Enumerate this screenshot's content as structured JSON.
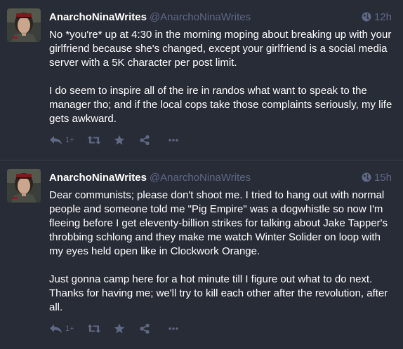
{
  "statuses": [
    {
      "display_name": "AnarchoNinaWrites",
      "handle": "@AnarchoNinaWrites",
      "time": "12h",
      "paragraphs": [
        "No *you're* up at 4:30 in the morning moping about breaking up with your girlfriend because she's changed, except your girlfriend is a social media server with a 5K character per post limit.",
        "I do seem to inspire all of the ire in randos what want to speak to the manager tho; and if the local cops take those complaints seriously, my life gets awkward."
      ],
      "reply_count": "1+"
    },
    {
      "display_name": "AnarchoNinaWrites",
      "handle": "@AnarchoNinaWrites",
      "time": "15h",
      "paragraphs": [
        "Dear communists; please don't shoot me. I tried to hang out with normal people and someone told me \"Pig Empire\" was a dogwhistle so now I'm fleeing before I get eleventy-billion strikes for talking about Jake Tapper's throbbing schlong and they make me watch Winter Solider on loop with my eyes held open like in Clockwork Orange.",
        "Just gonna camp here for a hot minute till I figure out what to do next. Thanks for having me; we'll try to kill each other after the revolution, after all."
      ],
      "reply_count": "1+"
    }
  ],
  "colors": {
    "background": "#282c37",
    "text": "#ffffff",
    "muted": "#606984",
    "divider": "#393f4f"
  },
  "icons": {
    "visibility": "globe-icon",
    "reply": "reply-all-icon",
    "boost": "retweet-icon",
    "favourite": "star-icon",
    "share": "share-icon",
    "more": "ellipsis-icon"
  }
}
